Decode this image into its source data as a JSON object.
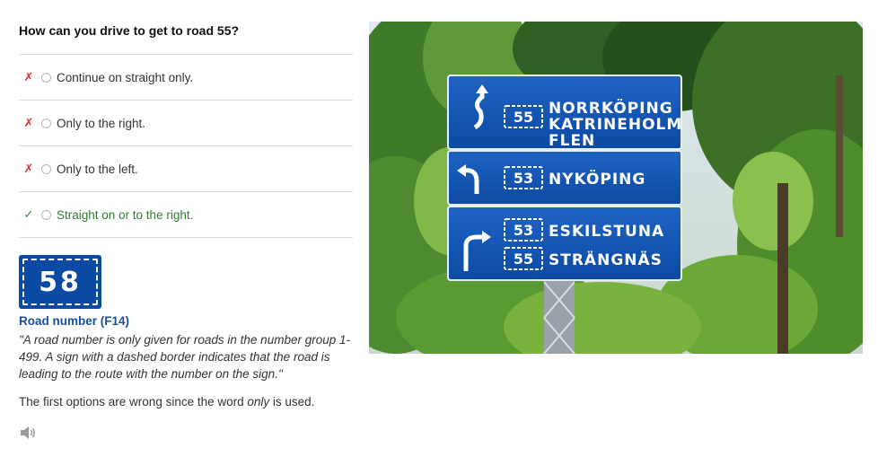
{
  "question": "How can you drive to get to road 55?",
  "options": [
    {
      "label": "Continue on straight only.",
      "mark": "✗",
      "status": "wrong"
    },
    {
      "label": "Only to the right.",
      "mark": "✗",
      "status": "wrong"
    },
    {
      "label": "Only to the left.",
      "mark": "✗",
      "status": "wrong"
    },
    {
      "label": "Straight on or to the right.",
      "mark": "✓",
      "status": "correct"
    }
  ],
  "road_sign": {
    "number": "58"
  },
  "road_number_title": "Road number (F14)",
  "quote": "\"A road number is only given for roads in the number group 1-499. A sign with a dashed border indicates that the road is leading to the route with the number on the sign.\"",
  "explanation": {
    "before": "The first options are wrong since the word ",
    "emphasis": "only",
    "after": " is used."
  },
  "photo_sign": {
    "panels": [
      {
        "routes": [
          "55"
        ],
        "destinations": [
          "NORRKÖPING",
          "KATRINEHOLM",
          "FLEN"
        ]
      },
      {
        "routes": [
          "53"
        ],
        "destinations": [
          "NYKÖPING"
        ]
      },
      {
        "routes": [
          "53",
          "55"
        ],
        "destinations": [
          "ESKILSTUNA",
          "STRÄNGNÄS"
        ]
      }
    ]
  },
  "colors": {
    "sign_blue": "#0b4aa2",
    "correct": "#2e7d2e",
    "wrong": "#e03030",
    "link": "#1a4f9c"
  },
  "icons": {
    "speaker": "speaker-icon"
  }
}
